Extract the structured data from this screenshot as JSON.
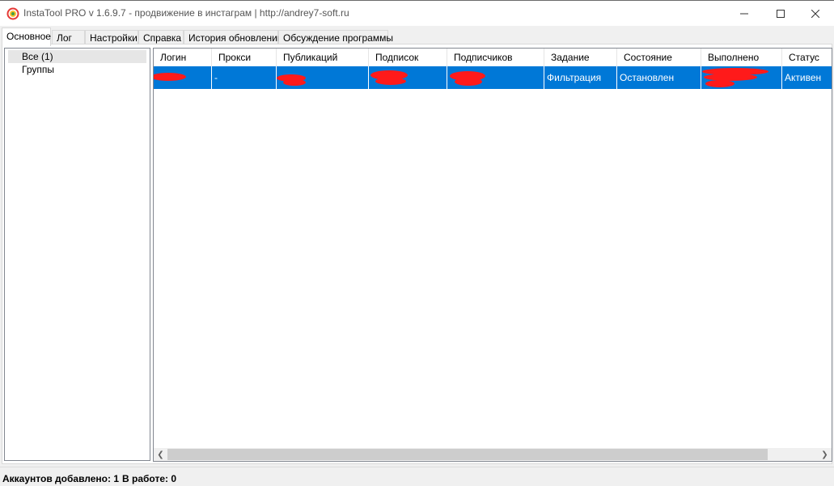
{
  "window": {
    "title": "InstaTool PRO v 1.6.9.7 - продвижение в инстаграм | http://andrey7-soft.ru",
    "icon": "instatool-logo-icon"
  },
  "tabs": [
    {
      "label": "Основное",
      "active": true
    },
    {
      "label": "Лог",
      "active": false
    },
    {
      "label": "Настройки",
      "active": false
    },
    {
      "label": "Справка",
      "active": false
    },
    {
      "label": "История обновлений",
      "active": false
    },
    {
      "label": "Обсуждение программы",
      "active": false
    }
  ],
  "tree": {
    "items": [
      {
        "label": "Все (1)",
        "selected": true
      },
      {
        "label": "Группы",
        "selected": false
      }
    ]
  },
  "grid": {
    "columns": [
      "Логин",
      "Прокси",
      "Публикаций",
      "Подписок",
      "Подписчиков",
      "Задание",
      "Состояние",
      "Выполнено",
      "Статус"
    ],
    "rows": [
      {
        "login": "",
        "proxy": "-",
        "posts": "",
        "following": "",
        "followers": "",
        "task": "Фильтрация",
        "state": "Остановлен",
        "done": "",
        "status": "Активен"
      }
    ],
    "selection_color": "#0078d7",
    "redaction_color": "#ff1a1a"
  },
  "statusbar": {
    "accounts_added": "Аккаунтов добавлено: 1",
    "in_work": "В работе: 0"
  }
}
